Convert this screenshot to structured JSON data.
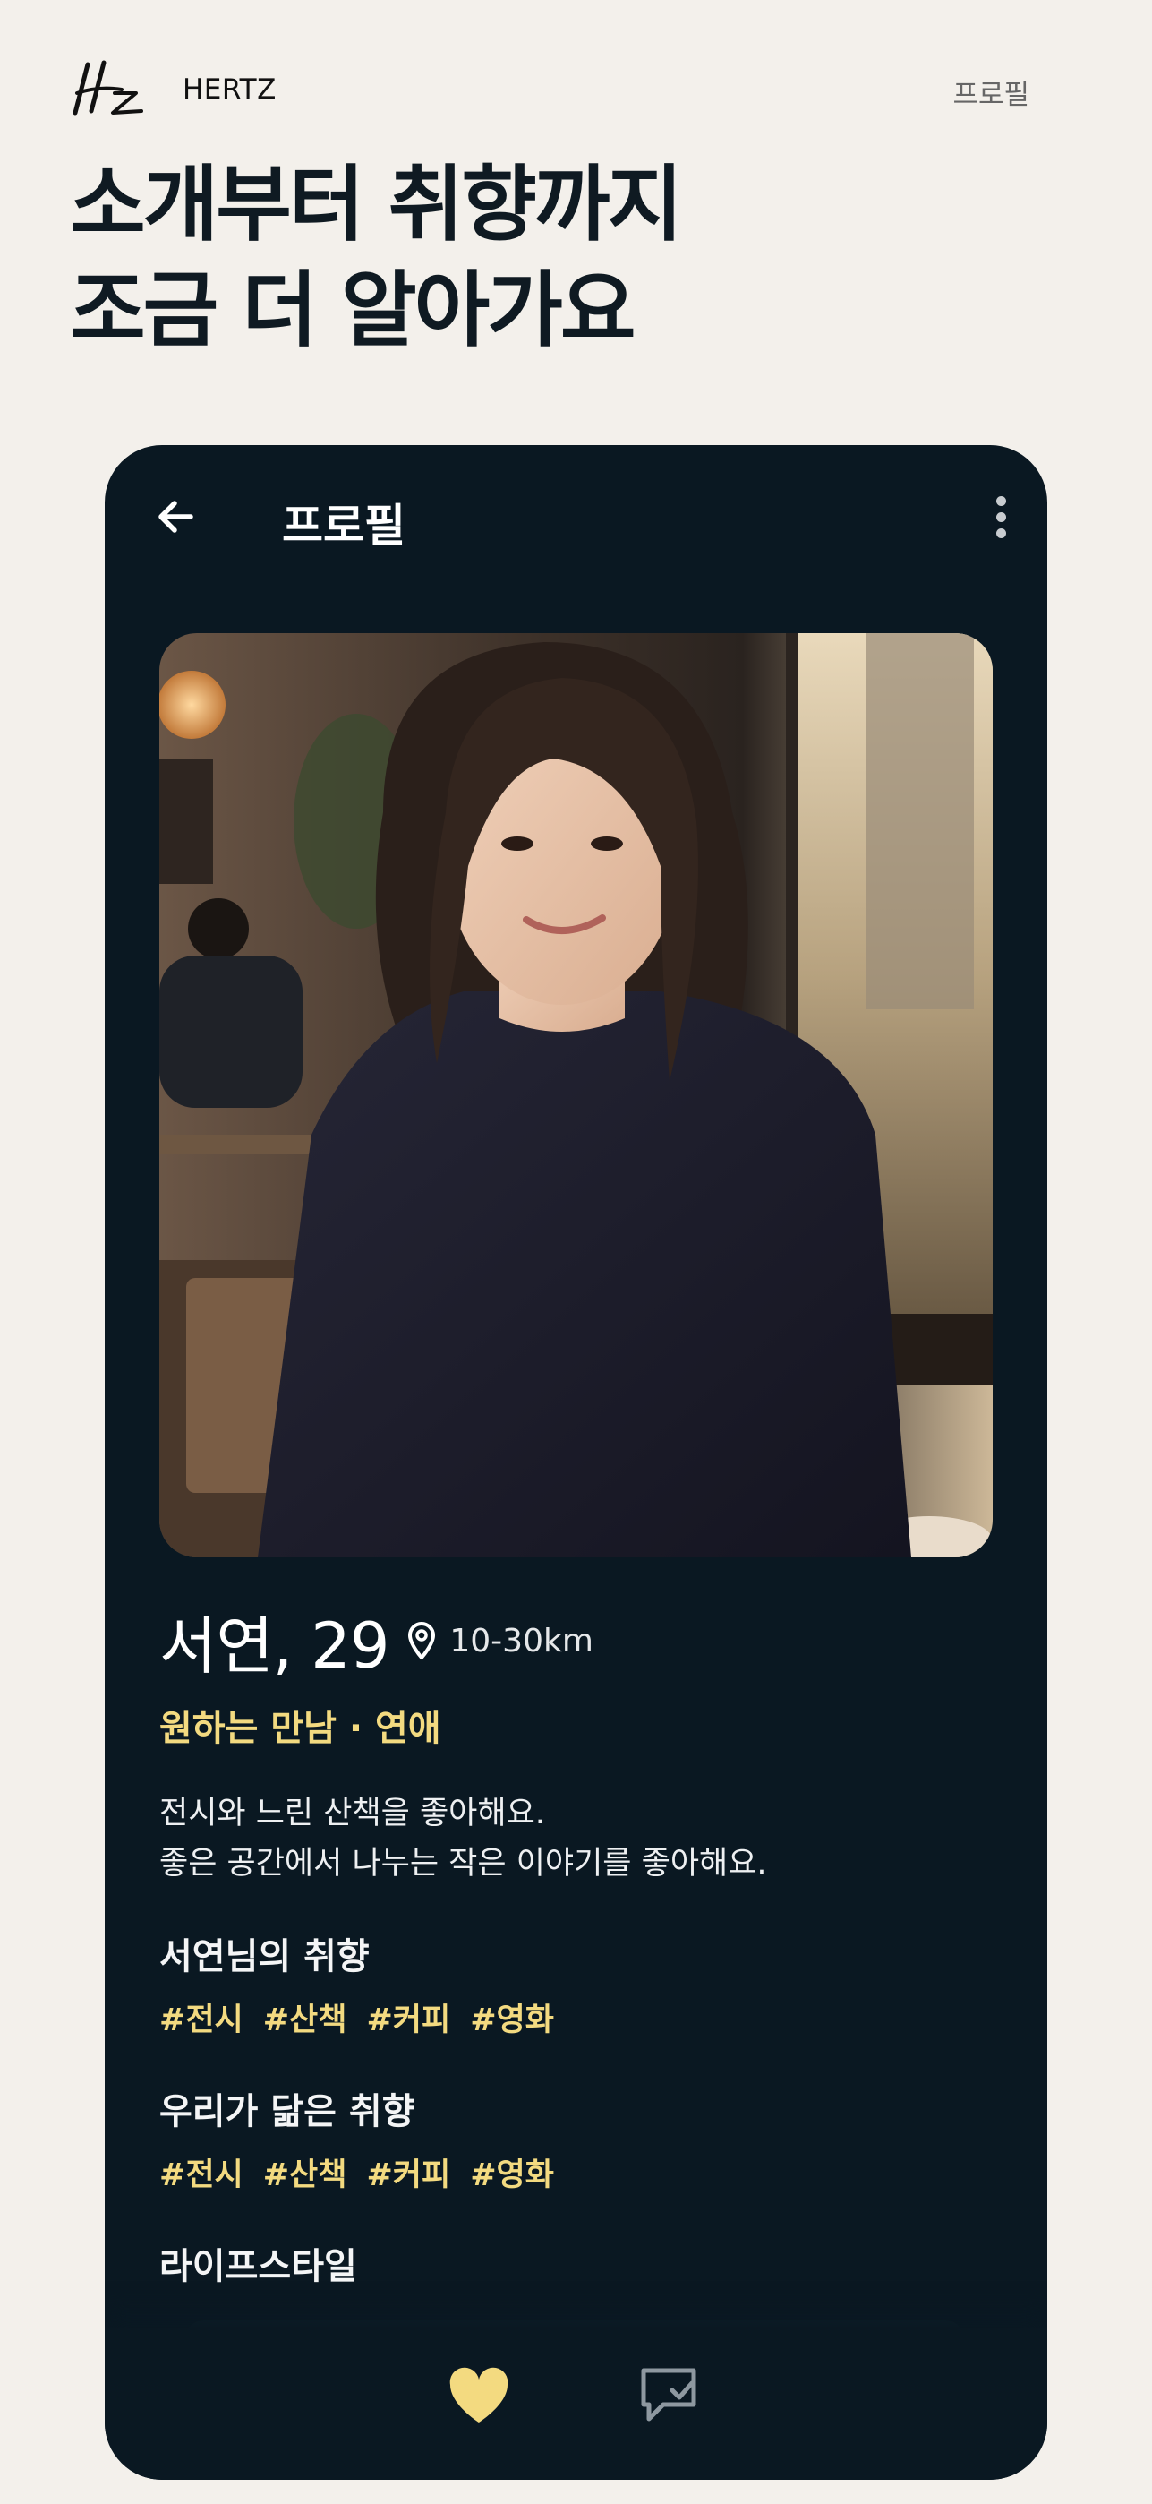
{
  "header": {
    "brand": "HERTZ",
    "profile_link": "프로필"
  },
  "headline": {
    "line1": "소개부터 취향까지",
    "line2": "조금 더 알아가요"
  },
  "app_bar": {
    "title": "프로필",
    "back_icon": "arrow-left-icon",
    "more_icon": "more-vertical-icon"
  },
  "profile": {
    "name_age": "서연, 29",
    "distance": "10-30km",
    "looking_for": "원하는 만남 · 연애",
    "intro": [
      "전시와 느린 산책을 좋아해요.",
      "좋은 공간에서 나누는 작은 이야기를 좋아해요."
    ]
  },
  "sections": {
    "my_tastes": {
      "title": "서연님의 취향",
      "tags": [
        "#전시",
        "#산책",
        "#커피",
        "#영화"
      ]
    },
    "shared_tastes": {
      "title": "우리가 닮은 취향",
      "tags": [
        "#전시",
        "#산책",
        "#커피",
        "#영화"
      ]
    },
    "lifestyle": {
      "title": "라이프스타일"
    }
  },
  "bottom_bar": {
    "like_icon": "heart-icon",
    "chat_icon": "chat-check-icon"
  },
  "colors": {
    "background": "#f3f0eb",
    "card": "#0a1822",
    "accent": "#f3da80"
  }
}
